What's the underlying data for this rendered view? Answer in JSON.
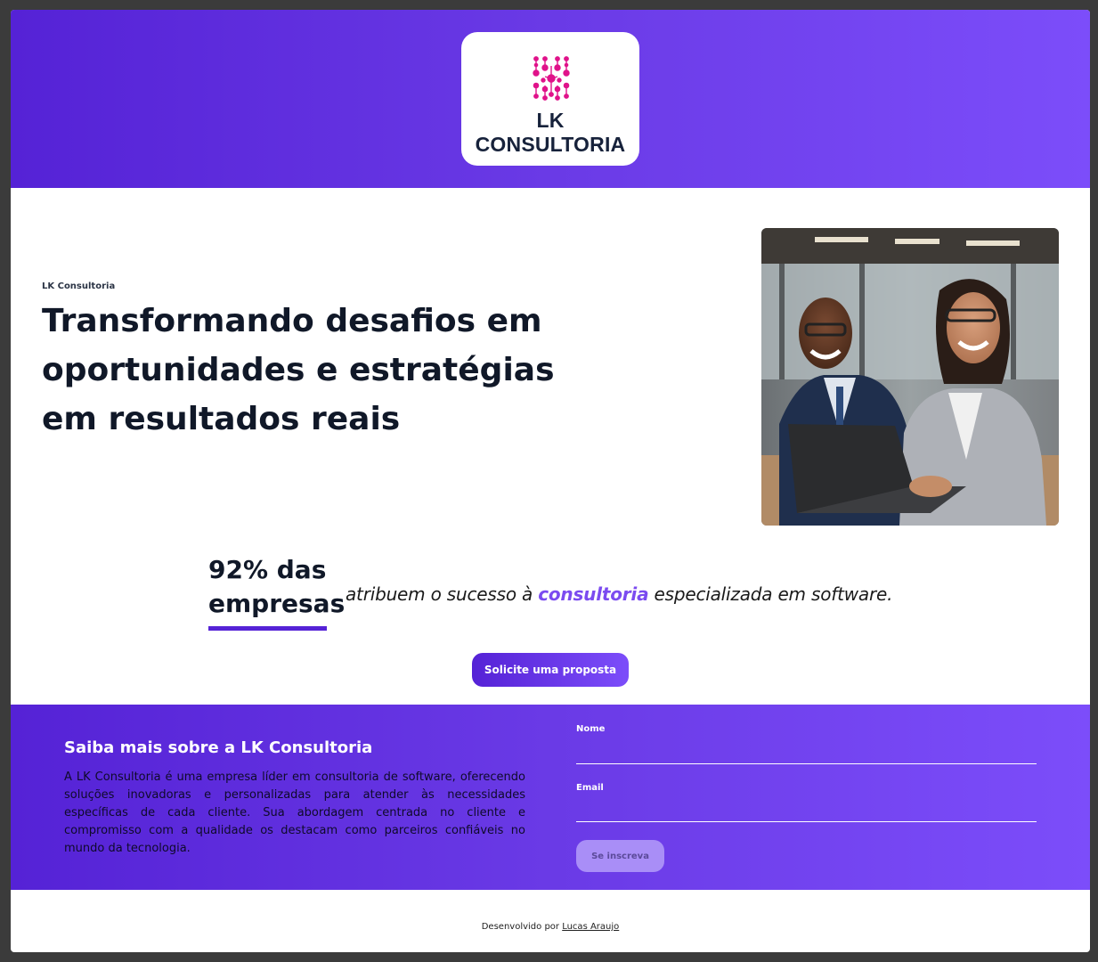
{
  "header": {
    "logo_text": "LK CONSULTORIA",
    "logo_icon": "circuit-dots-icon",
    "gradient_start": "#5522d6",
    "gradient_end": "#7c4dfa"
  },
  "hero": {
    "eyebrow": "LK Consultoria",
    "headline": "Transformando desafios em oportunidades e estratégias em resultados reais",
    "photo": "business-people-laptop-photo"
  },
  "stat": {
    "value": "92% das empresas",
    "desc_before": "atribuem o sucesso à ",
    "desc_highlight": "consultoria",
    "desc_after": " especializada em software.",
    "highlight_color": "#7b4bf0"
  },
  "cta": {
    "label": "Solicite uma proposta"
  },
  "about": {
    "title": "Saiba mais sobre a LK Consultoria",
    "text": "A LK Consultoria é uma empresa líder em consultoria de software, oferecendo soluções inovadoras e personalizadas para atender às necessidades específicas de cada cliente. Sua abordagem centrada no cliente e compromisso com a qualidade os destacam como parceiros confiáveis no mundo da tecnologia."
  },
  "form": {
    "name_label": "Nome",
    "name_value": "",
    "email_label": "Email",
    "email_value": "",
    "submit_label": "Se inscreva"
  },
  "footer": {
    "credit_prefix": "Desenvolvido por ",
    "credit_link": "Lucas Araujo"
  }
}
